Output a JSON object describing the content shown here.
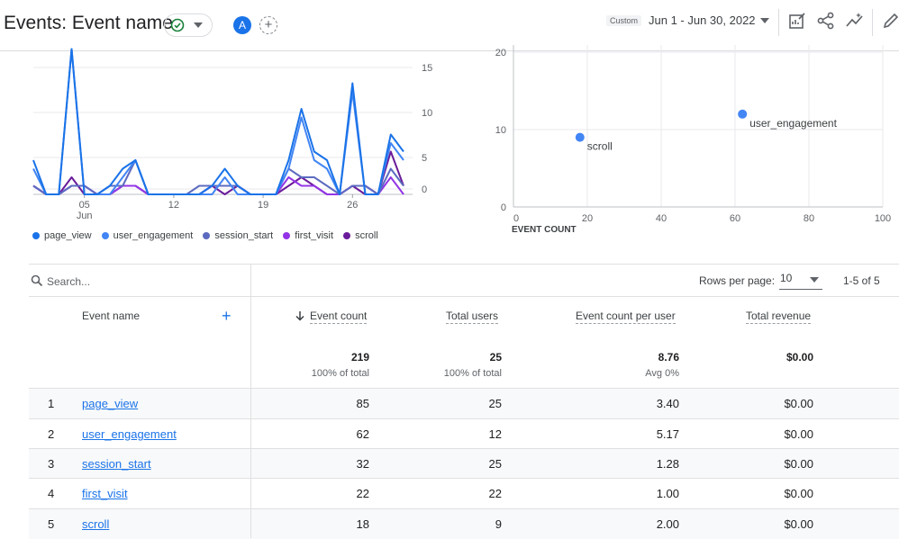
{
  "header": {
    "title": "Events: Event name",
    "avatar_letter": "A",
    "add_compare_symbol": "+",
    "custom_chip": "Custom",
    "date_range": "Jun 1 - Jun 30, 2022",
    "icons": [
      "check-circle-icon",
      "chevron-down-icon",
      "customize-report-icon",
      "share-icon",
      "insights-icon",
      "pencil-icon"
    ]
  },
  "line_chart": {
    "x_ticks": [
      "05",
      "12",
      "19",
      "26"
    ],
    "x_month_label": "Jun",
    "y_ticks": [
      "15",
      "10",
      "5",
      "0"
    ],
    "legend": [
      "page_view",
      "user_engagement",
      "session_start",
      "first_visit",
      "scroll"
    ]
  },
  "scatter_chart": {
    "x_label": "EVENT COUNT",
    "x_ticks": [
      "0",
      "20",
      "40",
      "60",
      "80",
      "100"
    ],
    "y_ticks": [
      "20",
      "10",
      "0"
    ]
  },
  "chart_data": [
    {
      "type": "line",
      "x": [
        "1",
        "2",
        "3",
        "4",
        "5",
        "6",
        "7",
        "8",
        "9",
        "10",
        "11",
        "12",
        "13",
        "14",
        "15",
        "16",
        "17",
        "18",
        "19",
        "20",
        "21",
        "22",
        "23",
        "24",
        "25",
        "26",
        "27",
        "28",
        "29",
        "30"
      ],
      "x_ticks": [
        "05",
        "12",
        "19",
        "26"
      ],
      "y_ticks": [
        "15",
        "10",
        "5",
        "0"
      ],
      "ylim": [
        0,
        16
      ],
      "series": [
        {
          "name": "page_view",
          "color": "#1a73e8",
          "values": [
            4,
            0,
            0,
            17,
            0,
            0,
            1,
            3,
            4,
            0,
            0,
            0,
            0,
            0,
            1,
            3,
            1,
            0,
            0,
            0,
            4,
            10,
            5,
            4,
            0,
            13,
            0,
            0,
            7,
            5
          ]
        },
        {
          "name": "user_engagement",
          "color": "#4285f4",
          "values": [
            3,
            0,
            0,
            17,
            0,
            0,
            0,
            2,
            4,
            0,
            0,
            0,
            0,
            0,
            0,
            2,
            0,
            0,
            0,
            0,
            3,
            9,
            4,
            3,
            0,
            12,
            0,
            0,
            6,
            4
          ]
        },
        {
          "name": "session_start",
          "color": "#5c6bc0",
          "values": [
            1,
            0,
            0,
            1,
            1,
            0,
            1,
            1,
            4,
            0,
            0,
            0,
            0,
            1,
            1,
            1,
            1,
            0,
            0,
            0,
            3,
            2,
            2,
            1,
            0,
            1,
            1,
            0,
            3,
            1
          ]
        },
        {
          "name": "first_visit",
          "color": "#9334e6",
          "values": [
            1,
            0,
            0,
            1,
            1,
            0,
            0,
            1,
            1,
            0,
            0,
            0,
            0,
            0,
            1,
            1,
            1,
            0,
            0,
            0,
            2,
            1,
            1,
            0,
            0,
            1,
            1,
            0,
            2,
            0
          ]
        },
        {
          "name": "scroll",
          "color": "#6a1b9a",
          "values": [
            1,
            0,
            0,
            2,
            0,
            0,
            0,
            1,
            1,
            0,
            0,
            0,
            0,
            0,
            1,
            0,
            1,
            0,
            0,
            0,
            1,
            2,
            1,
            0,
            0,
            1,
            0,
            0,
            5,
            1
          ]
        }
      ]
    },
    {
      "type": "scatter",
      "x_label": "EVENT COUNT",
      "xlim": [
        0,
        100
      ],
      "ylim": [
        0,
        20
      ],
      "points": [
        {
          "label": "scroll",
          "x": 18,
          "y": 9
        },
        {
          "label": "user_engagement",
          "x": 62,
          "y": 12
        }
      ]
    }
  ],
  "table": {
    "search_placeholder": "Search...",
    "rows_per_page_label": "Rows per page:",
    "rows_per_page_value": "10",
    "pagination": "1-5 of 5",
    "add_dimension_symbol": "+",
    "headers": {
      "event_name": "Event name",
      "event_count": "Event count",
      "total_users": "Total users",
      "event_count_per_user": "Event count per user",
      "total_revenue": "Total revenue"
    },
    "totals": {
      "event_count": "219",
      "event_count_sub": "100% of total",
      "total_users": "25",
      "total_users_sub": "100% of total",
      "event_count_per_user": "8.76",
      "event_count_per_user_sub": "Avg 0%",
      "total_revenue": "$0.00"
    },
    "rows": [
      {
        "rank": "1",
        "name": "page_view",
        "event_count": "85",
        "total_users": "25",
        "per_user": "3.40",
        "revenue": "$0.00"
      },
      {
        "rank": "2",
        "name": "user_engagement",
        "event_count": "62",
        "total_users": "12",
        "per_user": "5.17",
        "revenue": "$0.00"
      },
      {
        "rank": "3",
        "name": "session_start",
        "event_count": "32",
        "total_users": "25",
        "per_user": "1.28",
        "revenue": "$0.00"
      },
      {
        "rank": "4",
        "name": "first_visit",
        "event_count": "22",
        "total_users": "22",
        "per_user": "1.00",
        "revenue": "$0.00"
      },
      {
        "rank": "5",
        "name": "scroll",
        "event_count": "18",
        "total_users": "9",
        "per_user": "2.00",
        "revenue": "$0.00"
      }
    ]
  },
  "colors": {
    "accent": "#1a73e8",
    "success": "#188038",
    "text": "#202124",
    "muted": "#5f6368",
    "divider": "#e0e0e0",
    "row_band": "#f8f9fa"
  }
}
